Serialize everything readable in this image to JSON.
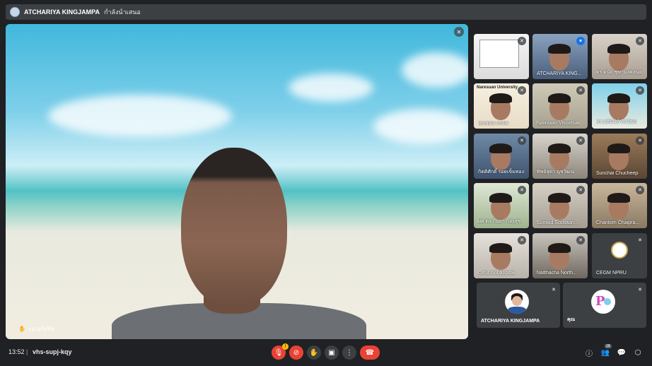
{
  "presenter": {
    "name": "ATCHARIYA KINGJAMPA",
    "status": "กำลังนำเสนอ"
  },
  "main": {
    "participant_name": "ผอ.สุภัสชัย"
  },
  "grid": [
    {
      "label": "",
      "icon": "mic-off-icon"
    },
    {
      "label": "ATCHARIYA KING...",
      "icon": "speaking-icon"
    },
    {
      "label": "ดร.ดนัย ชุษามงคลนย",
      "icon": "mic-off-icon"
    },
    {
      "label": "jayaphy cedar",
      "top": "Naresuan University",
      "icon": "mic-off-icon"
    },
    {
      "label": "Nalinlaan Visootsak",
      "icon": "mic-off-icon"
    },
    {
      "label": "ดร.ยศนันท์ กิจวัฒน",
      "icon": "mic-off-icon"
    },
    {
      "label": "กิตติศักดิ์ รอดเข็มทอง",
      "icon": "mic-off-icon"
    },
    {
      "label": "ทิพย์สุดา นุชวัฒน",
      "icon": "mic-off-icon"
    },
    {
      "label": "Sunchai Chucheep",
      "icon": "mic-off-icon"
    },
    {
      "label": "ผศ.ดร.กันยา กองสุข",
      "icon": "mic-off-icon"
    },
    {
      "label": "Somkid Soottitan...",
      "icon": "mic-off-icon"
    },
    {
      "label": "Chantorn Chaipra...",
      "icon": "mic-off-icon"
    },
    {
      "label": "Orrut siribanpitak",
      "icon": "mic-off-icon"
    },
    {
      "label": "Natthacha North...",
      "icon": "mic-off-icon"
    },
    {
      "label": "CEGM NPRU",
      "icon": "mic-off-icon"
    }
  ],
  "avatar_tiles": [
    {
      "label": "ATCHARIYA KINGJAMPA"
    },
    {
      "label": "คุณ"
    }
  ],
  "bottombar": {
    "time": "13:52",
    "separator": "|",
    "meeting_code": "vhs-supj-kqy",
    "mic_badge": "!",
    "participants_count": "18"
  },
  "colors": {
    "background": "#202124",
    "tile": "#3c4043",
    "danger": "#ea4335",
    "accent": "#1a73e8",
    "warning": "#fbbc04"
  }
}
